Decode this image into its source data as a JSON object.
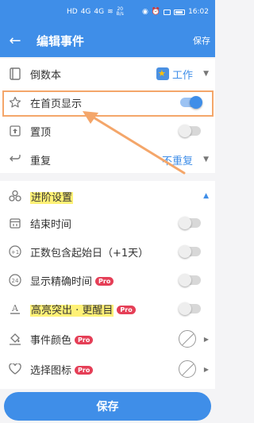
{
  "status_bar": {
    "left_items": [
      "HD",
      "4G",
      "4G"
    ],
    "speed": "20\nB/s",
    "time": "16:02"
  },
  "app_bar": {
    "back_icon": "arrow-left-icon",
    "title": "编辑事件",
    "save_label": "保存"
  },
  "rows": {
    "countdown_book": {
      "label": "倒数本",
      "value": "工作",
      "icon": "book-icon"
    },
    "show_home": {
      "label": "在首页显示",
      "on": true,
      "icon": "star-icon"
    },
    "pin_top": {
      "label": "置顶",
      "on": false,
      "icon": "pin-icon"
    },
    "repeat": {
      "label": "重复",
      "value": "不重复",
      "icon": "repeat-icon"
    }
  },
  "advanced": {
    "header": "进阶设置",
    "end_time": {
      "label": "结束时间",
      "on": false
    },
    "include_start": {
      "label": "正数包含起始日（+1天）",
      "on": false
    },
    "precise_time": {
      "label": "显示精确时间",
      "badge": "Pro",
      "on": false
    },
    "highlight": {
      "label": "高亮突出 · 更醒目",
      "badge": "Pro",
      "on": false
    },
    "event_color": {
      "label": "事件颜色",
      "badge": "Pro"
    },
    "choose_icon": {
      "label": "选择图标",
      "badge": "Pro"
    }
  },
  "bottom": {
    "save_label": "保存"
  },
  "colors": {
    "primary": "#3f8ee8",
    "pro": "#e53f57",
    "annotation": "#f4a66a"
  }
}
